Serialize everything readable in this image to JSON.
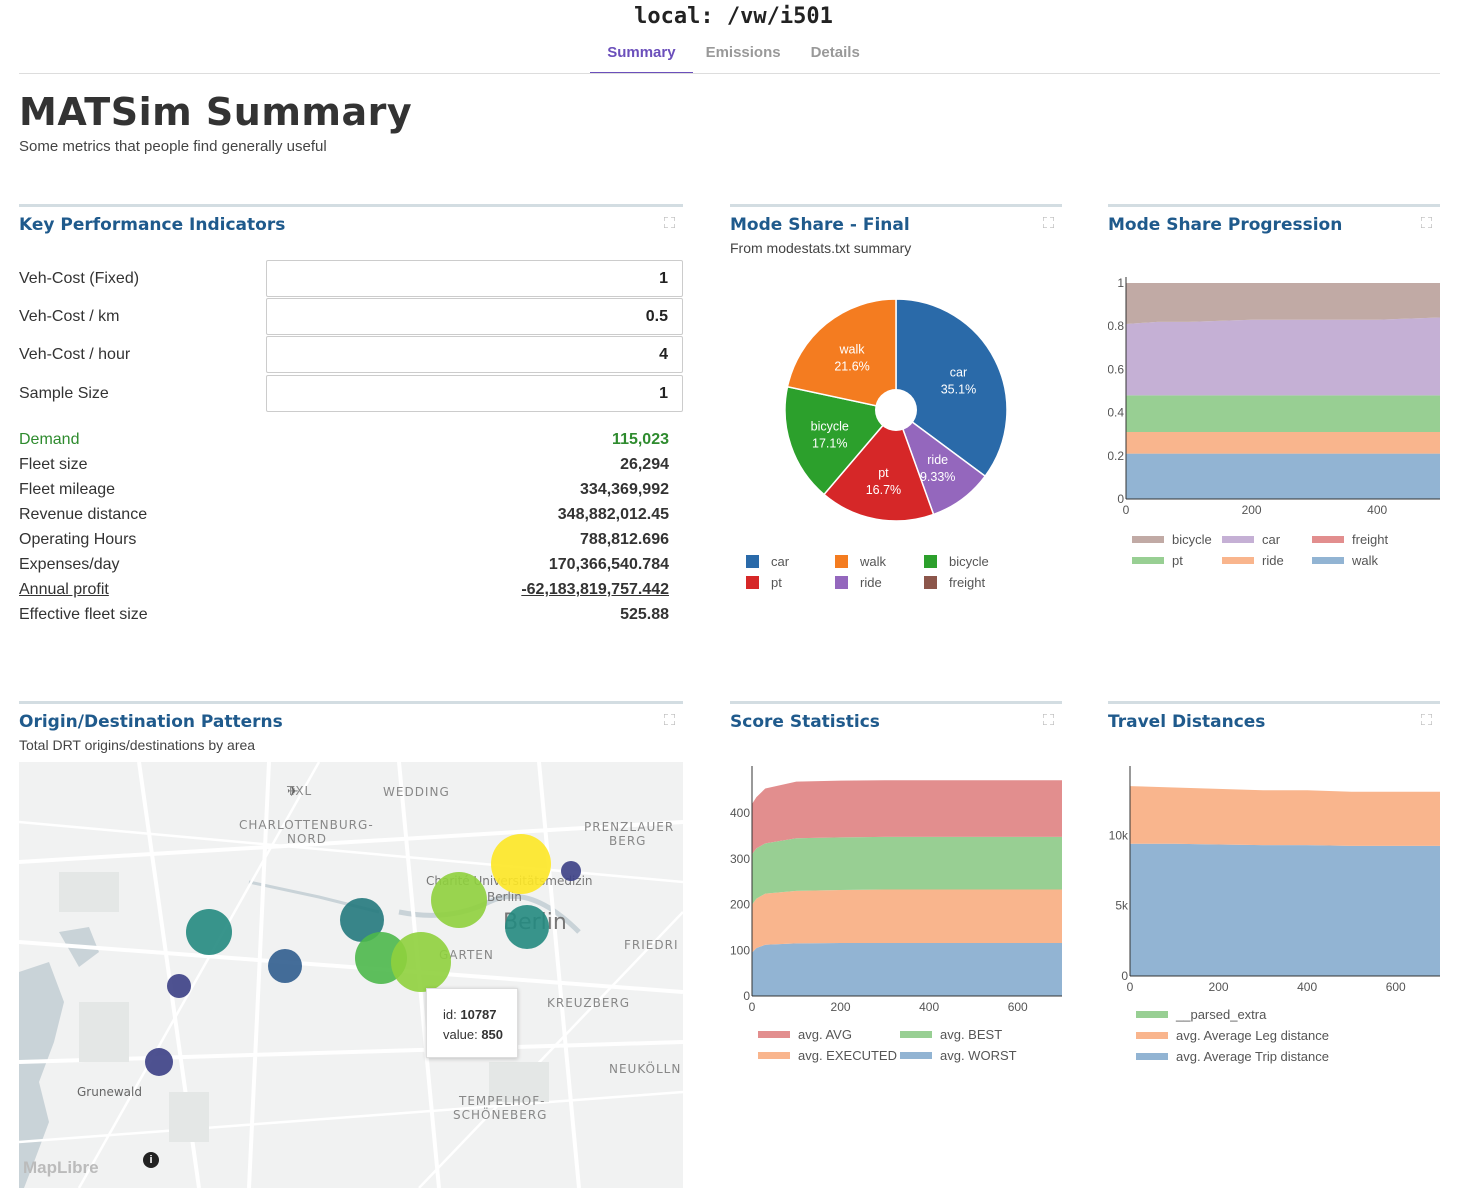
{
  "app_title": "local: /vw/i501",
  "tabs": [
    {
      "label": "Summary",
      "active": true
    },
    {
      "label": "Emissions",
      "active": false
    },
    {
      "label": "Details",
      "active": false
    }
  ],
  "page": {
    "title": "MATSim Summary",
    "subtitle": "Some metrics that people find generally useful"
  },
  "kpi": {
    "title": "Key Performance Indicators",
    "inputs": [
      {
        "label": "Veh-Cost (Fixed)",
        "value": "1"
      },
      {
        "label": "Veh-Cost / km",
        "value": "0.5"
      },
      {
        "label": "Veh-Cost / hour",
        "value": "4"
      },
      {
        "label": "Sample Size",
        "value": "1"
      }
    ],
    "stats": [
      {
        "label": "Demand",
        "value": "115,023"
      },
      {
        "label": "Fleet size",
        "value": "26,294"
      },
      {
        "label": "Fleet mileage",
        "value": "334,369,992"
      },
      {
        "label": "Revenue distance",
        "value": "348,882,012.45"
      },
      {
        "label": "Operating Hours",
        "value": "788,812.696"
      },
      {
        "label": "Expenses/day",
        "value": "170,366,540.784"
      },
      {
        "label": "Annual profit",
        "value": "-62,183,819,757.442"
      },
      {
        "label": "Effective fleet size",
        "value": "525.88"
      }
    ]
  },
  "mode_share": {
    "title": "Mode Share - Final",
    "subtitle": "From modestats.txt summary"
  },
  "mode_progression": {
    "title": "Mode Share Progression"
  },
  "od": {
    "title": "Origin/Destination Patterns",
    "subtitle": "Total DRT origins/destinations by area",
    "map_labels": [
      "TXL",
      "WEDDING",
      "CHARLOTTENBURG-",
      "NORD",
      "PRENZLAUER",
      "BERG",
      "Charité Universitätsmedizin",
      "Berlin",
      "Berlin",
      "FRIEDRI",
      "GARTEN",
      "KREUZBERG",
      "NEUKÖLLN",
      "Grunewald",
      "TEMPELHOF-",
      "SCHÖNEBERG",
      "MapLibre"
    ],
    "tooltip": {
      "id_label": "id:",
      "id_value": "10787",
      "value_label": "value:",
      "value_value": "850"
    }
  },
  "score": {
    "title": "Score Statistics"
  },
  "travel": {
    "title": "Travel Distances"
  },
  "colors": {
    "accent": "#6b4fbb",
    "panel_title": "#1f5a8c",
    "car": "#2a6aa9",
    "walk": "#f47c20",
    "bicycle": "#2ca02c",
    "pt": "#d62728",
    "ride": "#9467bd",
    "freight": "#8c564b"
  },
  "chart_data": [
    {
      "type": "pie",
      "categories": [
        "car",
        "ride",
        "pt",
        "bicycle",
        "walk"
      ],
      "values": [
        35.1,
        9.33,
        16.7,
        17.1,
        21.6
      ],
      "labels": [
        "35.1%",
        "9.33%",
        "16.7%",
        "17.1%",
        "21.6%"
      ],
      "legend": [
        "car",
        "walk",
        "bicycle",
        "pt",
        "ride",
        "freight"
      ],
      "legend_placement": "bottom",
      "donut": true
    },
    {
      "type": "area",
      "stacked": true,
      "x": [
        0,
        50,
        100,
        200,
        300,
        400,
        500
      ],
      "xticks": [
        "0",
        "200",
        "400"
      ],
      "yticks": [
        "0",
        "0.2",
        "0.4",
        "0.6",
        "0.8",
        "1"
      ],
      "ylim": [
        0,
        1
      ],
      "xlim": [
        0,
        500
      ],
      "series": [
        {
          "name": "walk",
          "values": [
            0.21,
            0.21,
            0.21,
            0.21,
            0.21,
            0.21,
            0.21
          ]
        },
        {
          "name": "ride",
          "values": [
            0.1,
            0.1,
            0.1,
            0.1,
            0.1,
            0.1,
            0.1
          ]
        },
        {
          "name": "pt",
          "values": [
            0.17,
            0.17,
            0.17,
            0.17,
            0.17,
            0.17,
            0.17
          ]
        },
        {
          "name": "car",
          "values": [
            0.33,
            0.34,
            0.34,
            0.35,
            0.35,
            0.35,
            0.36
          ]
        },
        {
          "name": "bicycle",
          "values": [
            0.19,
            0.18,
            0.18,
            0.17,
            0.17,
            0.17,
            0.16
          ]
        },
        {
          "name": "freight",
          "values": [
            0,
            0,
            0,
            0,
            0,
            0,
            0
          ]
        }
      ],
      "legend": [
        "bicycle",
        "car",
        "freight",
        "pt",
        "ride",
        "walk"
      ]
    },
    {
      "type": "area",
      "stacked": true,
      "x": [
        0,
        10,
        30,
        100,
        200,
        300,
        400,
        500,
        600,
        700
      ],
      "xticks": [
        "0",
        "200",
        "400",
        "600"
      ],
      "yticks": [
        "0",
        "100",
        "200",
        "300",
        "400"
      ],
      "ylim": [
        0,
        490
      ],
      "xlim": [
        0,
        700
      ],
      "series": [
        {
          "name": "avg. WORST",
          "values": [
            95,
            105,
            112,
            115,
            116,
            116,
            116,
            116,
            116,
            116
          ]
        },
        {
          "name": "avg. EXECUTED",
          "values": [
            105,
            108,
            112,
            115,
            116,
            117,
            117,
            117,
            117,
            117
          ]
        },
        {
          "name": "avg. BEST",
          "values": [
            110,
            110,
            110,
            115,
            115,
            115,
            115,
            115,
            115,
            115
          ]
        },
        {
          "name": "avg. AVG",
          "values": [
            110,
            112,
            120,
            124,
            124,
            124,
            124,
            124,
            124,
            124
          ]
        }
      ],
      "legend": [
        "avg. AVG",
        "avg. BEST",
        "avg. EXECUTED",
        "avg. WORST"
      ]
    },
    {
      "type": "area",
      "stacked": true,
      "x": [
        0,
        100,
        200,
        300,
        400,
        500,
        600,
        700
      ],
      "xticks": [
        "0",
        "200",
        "400",
        "600"
      ],
      "yticks": [
        "0",
        "5k",
        "10k"
      ],
      "ylim": [
        0,
        14500
      ],
      "xlim": [
        0,
        700
      ],
      "series": [
        {
          "name": "avg. Average Trip distance",
          "values": [
            9400,
            9400,
            9350,
            9300,
            9300,
            9250,
            9250,
            9250
          ]
        },
        {
          "name": "avg. Average Leg distance",
          "values": [
            4100,
            4000,
            3950,
            3900,
            3900,
            3850,
            3850,
            3850
          ]
        },
        {
          "name": "__parsed_extra",
          "values": [
            0,
            0,
            0,
            0,
            0,
            0,
            0,
            0
          ]
        }
      ],
      "legend": [
        "__parsed_extra",
        "avg. Average Leg distance",
        "avg. Average Trip distance"
      ]
    }
  ]
}
